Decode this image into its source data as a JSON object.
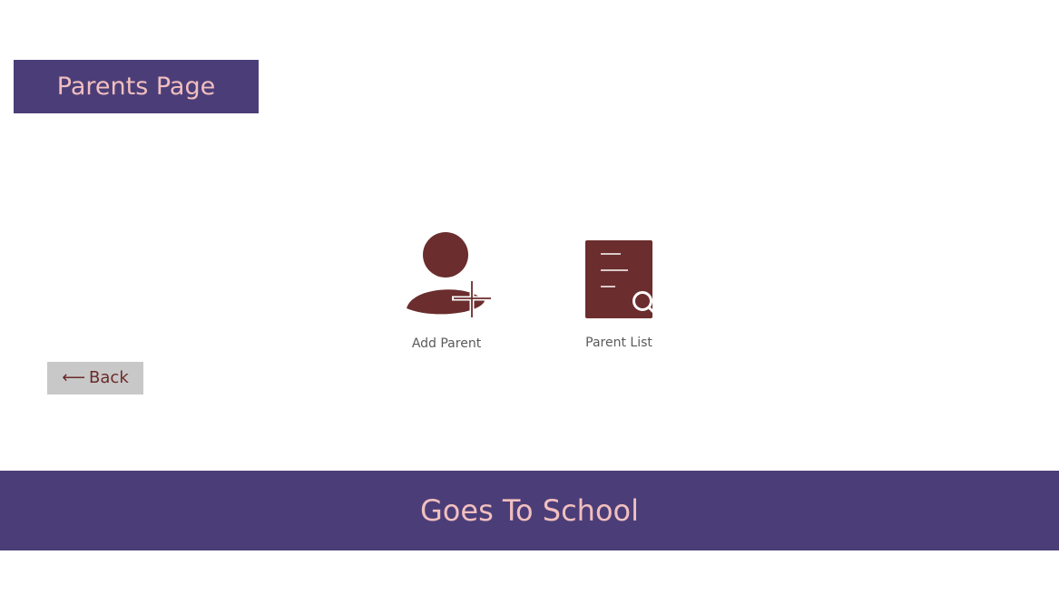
{
  "header": {
    "title": "Parents Page"
  },
  "tiles": [
    {
      "label": "Add Parent",
      "icon": "add-user-icon"
    },
    {
      "label": "Parent List",
      "icon": "document-search-icon"
    }
  ],
  "back": {
    "arrow": "⟵",
    "label": "Back"
  },
  "footer": {
    "text": "Goes To School"
  },
  "colors": {
    "brand_purple": "#4b3e78",
    "accent_pink": "#f2bfbf",
    "icon_maroon": "#6b2d2d",
    "back_button_bg": "#c8c8c8"
  }
}
